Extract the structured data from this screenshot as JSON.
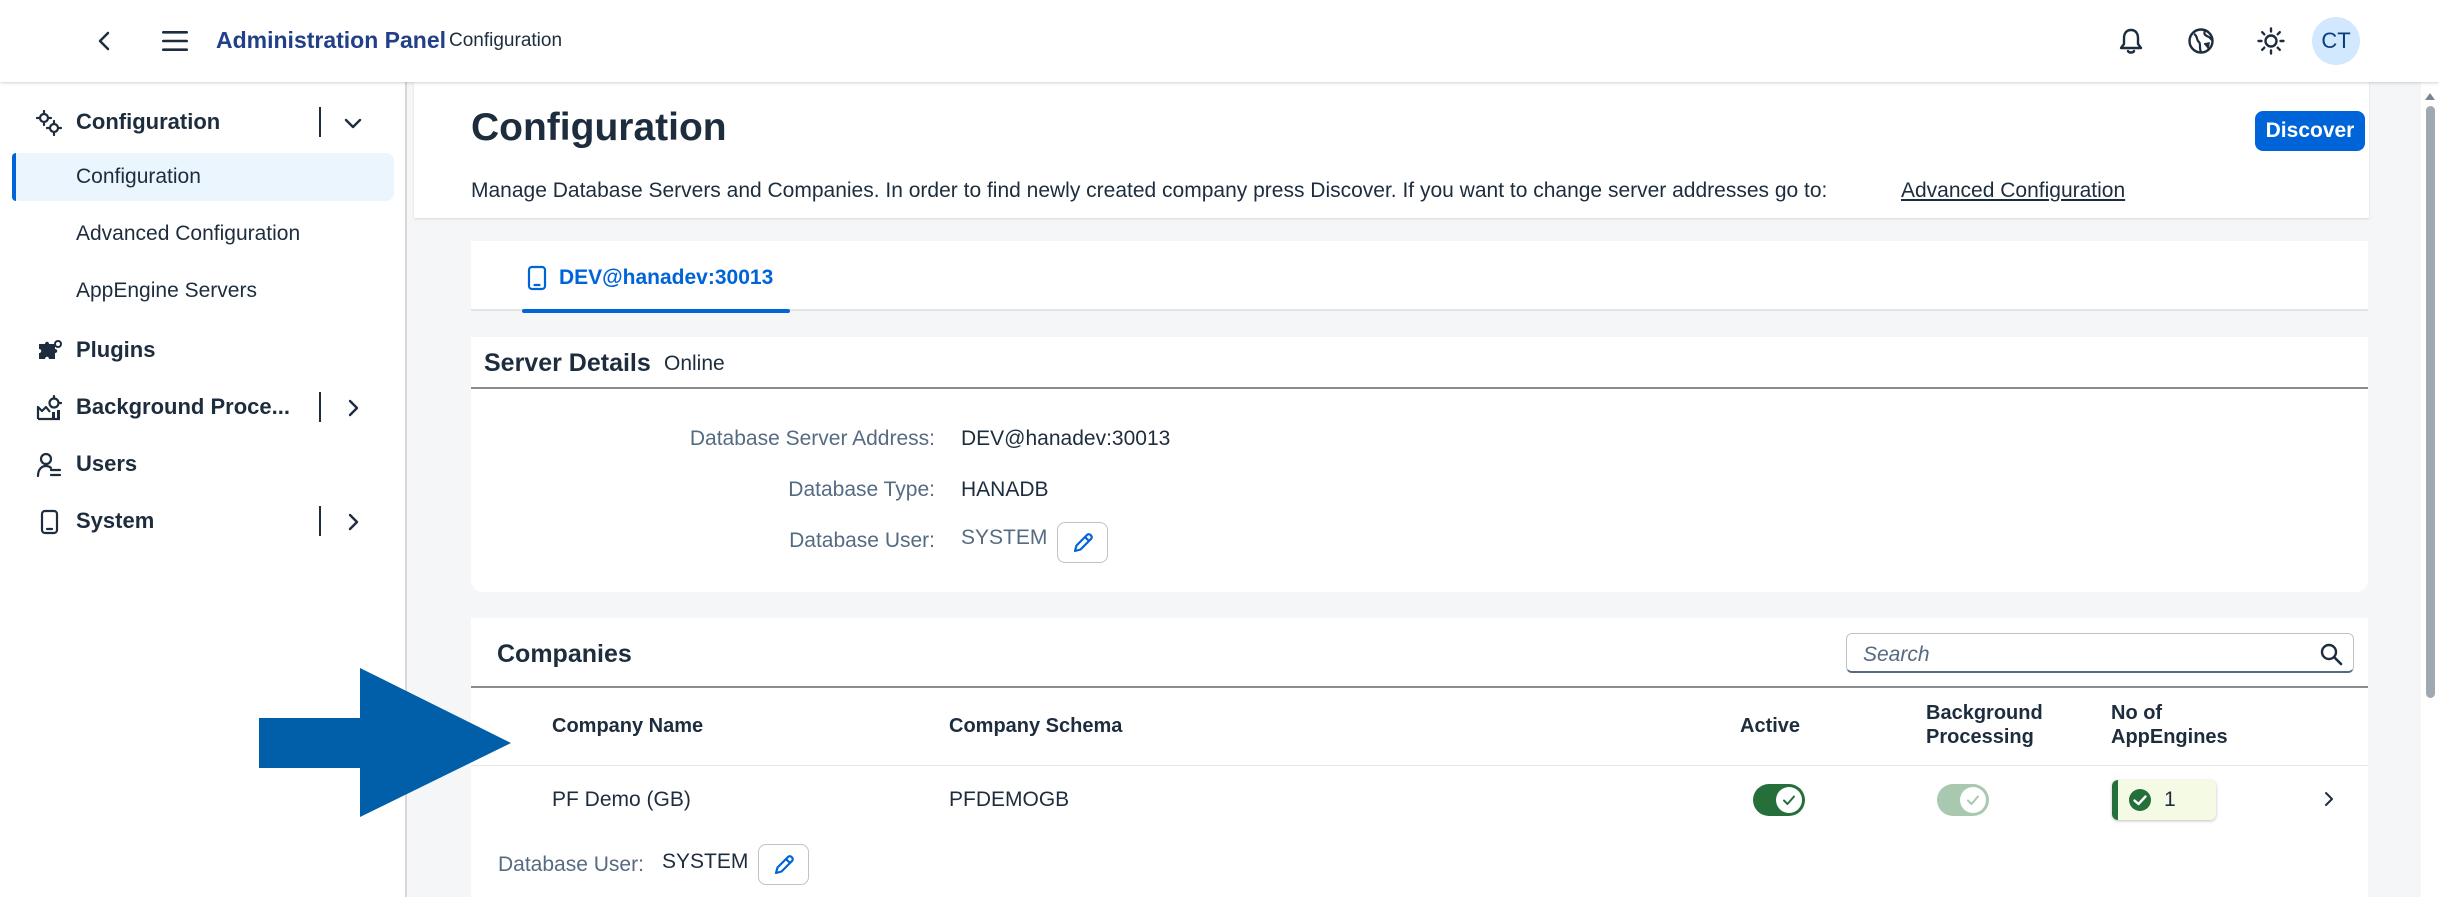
{
  "shellbar": {
    "title": "Administration Panel",
    "subtitle": "Configuration",
    "avatar_initials": "CT",
    "icons": [
      "back-icon",
      "menu-icon",
      "bell-icon",
      "globe-icon",
      "sun-icon"
    ]
  },
  "sidenav": {
    "items": [
      {
        "label": "Configuration",
        "icon": "gears-icon",
        "expanded": true
      },
      {
        "label": "Plugins",
        "icon": "puzzle-icon"
      },
      {
        "label": "Background Proce...",
        "icon": "process-icon"
      },
      {
        "label": "Users",
        "icon": "user-icon"
      },
      {
        "label": "System",
        "icon": "device-icon"
      }
    ],
    "subitems": [
      {
        "label": "Configuration",
        "selected": true
      },
      {
        "label": "Advanced Configuration"
      },
      {
        "label": "AppEngine Servers"
      }
    ]
  },
  "page": {
    "title": "Configuration",
    "discover_label": "Discover",
    "description": "Manage Database Servers and Companies. In order to find newly created company press Discover. If you want to change server addresses go to:",
    "advanced_link": "Advanced Configuration"
  },
  "tabs": [
    {
      "label": "DEV@hanadev:30013",
      "icon": "device-icon",
      "selected": true
    }
  ],
  "server_details": {
    "title": "Server Details",
    "status": "Online",
    "fields": [
      {
        "label": "Database Server Address:",
        "value": "DEV@hanadev:30013"
      },
      {
        "label": "Database Type:",
        "value": "HANADB"
      },
      {
        "label": "Database User:",
        "value": "SYSTEM"
      }
    ]
  },
  "companies": {
    "title": "Companies",
    "search_placeholder": "Search",
    "columns": {
      "name": "Company Name",
      "schema": "Company Schema",
      "active": "Active",
      "background_line1": "Background",
      "background_line2": "Processing",
      "appengines_line1": "No of",
      "appengines_line2": "AppEngines"
    },
    "rows": [
      {
        "name": "PF Demo (GB)",
        "schema": "PFDEMOGB",
        "active": true,
        "background_processing": true,
        "appengines": "1",
        "db_user_label": "Database User:",
        "db_user": "SYSTEM"
      }
    ]
  },
  "colors": {
    "accent": "#0064d9",
    "brand_title": "#223f8a",
    "switch_on": "#256f3a",
    "switch_disabled": "#a9c8b0",
    "arrow": "#005fa8"
  }
}
